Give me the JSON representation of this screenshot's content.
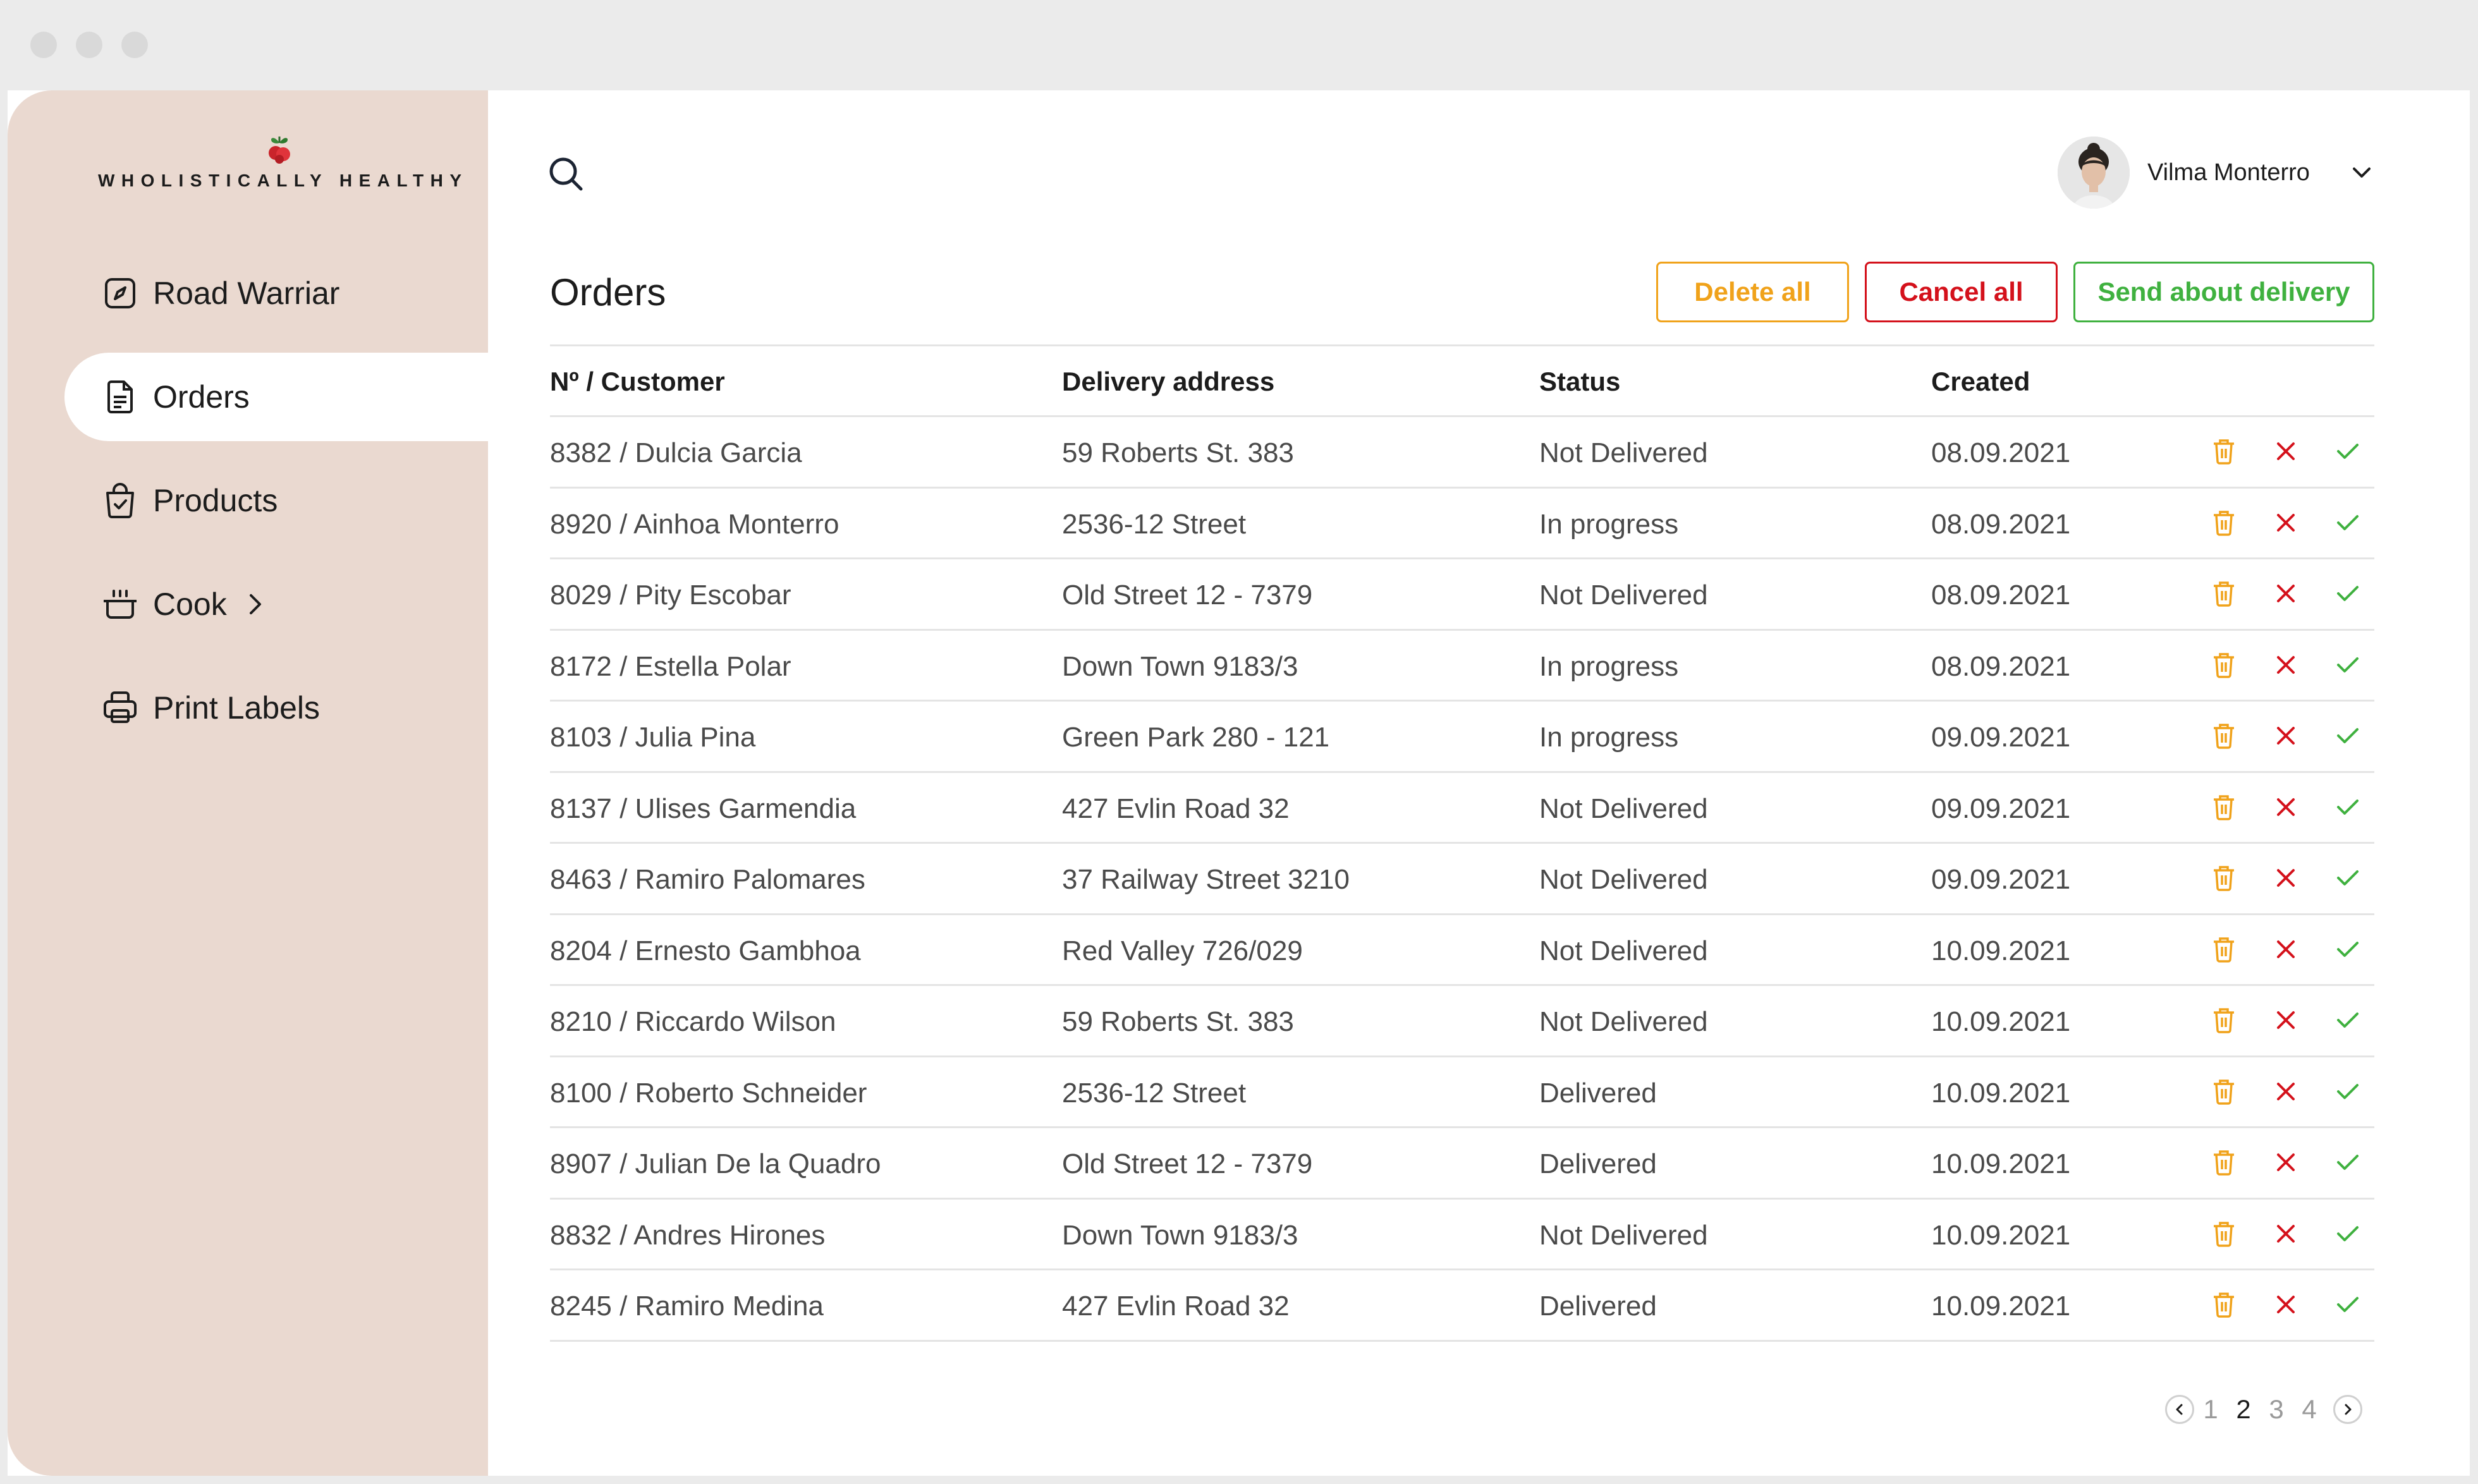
{
  "app": {
    "logo_text": "WHOLISTICALLY HEALTHY"
  },
  "sidebar": {
    "items": [
      {
        "label": "Road Warriar",
        "icon": "compass-icon",
        "active": false
      },
      {
        "label": "Orders",
        "icon": "document-icon",
        "active": true
      },
      {
        "label": "Products",
        "icon": "shopping-bag-icon",
        "active": false
      },
      {
        "label": "Cook",
        "icon": "pot-icon",
        "active": false,
        "has_submenu": true
      },
      {
        "label": "Print Labels",
        "icon": "printer-icon",
        "active": false
      }
    ]
  },
  "header": {
    "search_icon": "search-icon",
    "user_name": "Vilma Monterro"
  },
  "page": {
    "title": "Orders",
    "actions": {
      "delete_all": "Delete all",
      "cancel_all": "Cancel all",
      "send_about_delivery": "Send about delivery"
    }
  },
  "table": {
    "columns": [
      "Nº / Customer",
      "Delivery address",
      "Status",
      "Created"
    ],
    "rows": [
      {
        "customer": "8382 / Dulcia Garcia",
        "address": "59 Roberts St. 383",
        "status": "Not Delivered",
        "created": "08.09.2021"
      },
      {
        "customer": "8920 / Ainhoa Monterro",
        "address": "2536-12 Street",
        "status": "In progress",
        "created": "08.09.2021"
      },
      {
        "customer": "8029 / Pity Escobar",
        "address": "Old Street 12 - 7379",
        "status": "Not Delivered",
        "created": "08.09.2021"
      },
      {
        "customer": "8172 / Estella Polar",
        "address": "Down Town 9183/3",
        "status": "In progress",
        "created": "08.09.2021"
      },
      {
        "customer": "8103 / Julia Pina",
        "address": "Green Park 280 - 121",
        "status": "In progress",
        "created": "09.09.2021"
      },
      {
        "customer": "8137 / Ulises Garmendia",
        "address": "427 Evlin Road 32",
        "status": "Not Delivered",
        "created": "09.09.2021"
      },
      {
        "customer": "8463 / Ramiro Palomares",
        "address": "37 Railway Street 3210",
        "status": "Not Delivered",
        "created": "09.09.2021"
      },
      {
        "customer": "8204 / Ernesto Gambhoa",
        "address": "Red Valley 726/029",
        "status": "Not Delivered",
        "created": "10.09.2021"
      },
      {
        "customer": "8210 / Riccardo Wilson",
        "address": "59 Roberts St. 383",
        "status": "Not Delivered",
        "created": "10.09.2021"
      },
      {
        "customer": "8100 / Roberto Schneider",
        "address": "2536-12 Street",
        "status": "Delivered",
        "created": "10.09.2021"
      },
      {
        "customer": "8907 / Julian De la Quadro",
        "address": "Old Street 12 - 7379",
        "status": "Delivered",
        "created": "10.09.2021"
      },
      {
        "customer": "8832 / Andres Hirones",
        "address": "Down Town 9183/3",
        "status": "Not Delivered",
        "created": "10.09.2021"
      },
      {
        "customer": "8245 / Ramiro Medina",
        "address": "427 Evlin Road 32",
        "status": "Delivered",
        "created": "10.09.2021"
      }
    ]
  },
  "pagination": {
    "pages": [
      "1",
      "2",
      "3",
      "4"
    ],
    "current": "2"
  },
  "colors": {
    "sidebar_bg": "#ead9d0",
    "delete": "#f0a21a",
    "cancel": "#d4111b",
    "confirm": "#3fb13f"
  }
}
